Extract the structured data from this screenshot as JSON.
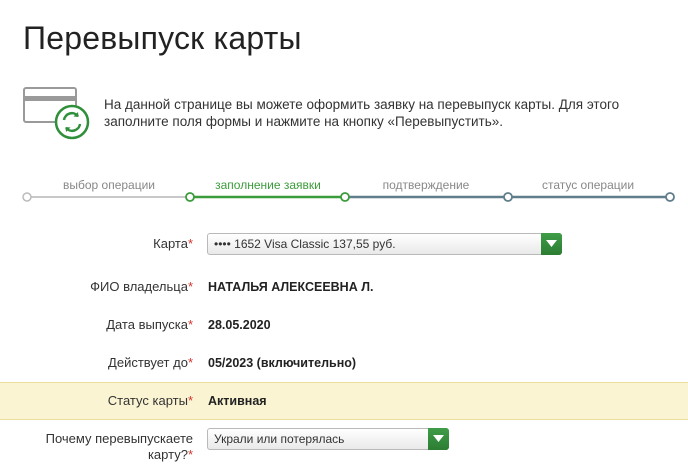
{
  "page_title": "Перевыпуск карты",
  "intro_text": "На данной странице вы можете оформить заявку на перевыпуск карты. Для этого заполните поля формы и нажмите на кнопку «Перевыпустить».",
  "steps": [
    {
      "label": "выбор операции",
      "state": "done"
    },
    {
      "label": "заполнение заявки",
      "state": "active"
    },
    {
      "label": "подтверждение",
      "state": "pending"
    },
    {
      "label": "статус операции",
      "state": "pending"
    }
  ],
  "form": {
    "card": {
      "label": "Карта",
      "required_mark": "*",
      "value": "•••• 1652  Visa Classic  137,55  руб."
    },
    "owner": {
      "label": "ФИО владельца",
      "required_mark": "*",
      "value": "НАТАЛЬЯ АЛЕКСЕЕВНА Л."
    },
    "issue_date": {
      "label": "Дата выпуска",
      "required_mark": "*",
      "value": "28.05.2020"
    },
    "valid_until": {
      "label": "Действует до",
      "required_mark": "*",
      "value": "05/2023 (включительно)"
    },
    "status": {
      "label": "Статус карты",
      "required_mark": "*",
      "value": "Активная"
    },
    "reason": {
      "label_line1": "Почему перевыпускаете",
      "label_line2": "карту?",
      "required_mark": "*",
      "value": "Украли или потерялась"
    }
  },
  "colors": {
    "accent_green": "#3b9c3b",
    "step_pending": "#607d8b",
    "required": "#d0342c",
    "highlight_bg": "#fbf4d2"
  },
  "icons": {
    "card_illustration": "card-reissue-icon",
    "select_chevron": "chevron-down-icon"
  }
}
